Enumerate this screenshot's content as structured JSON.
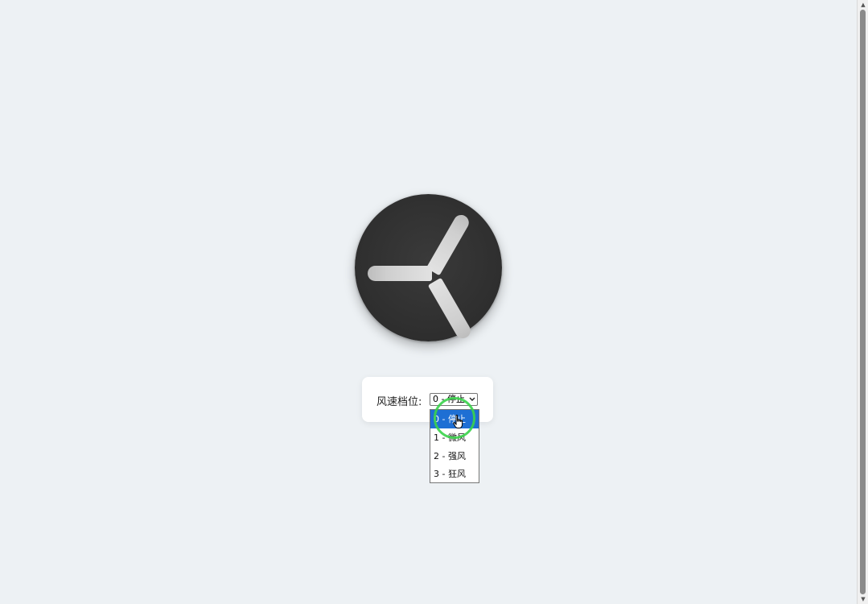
{
  "control": {
    "label": "风速档位:",
    "selected_value": "0 - 停止",
    "options": [
      "0 - 停止",
      "1 - 微风",
      "2 - 强风",
      "3 - 狂风"
    ],
    "highlighted_index": 0
  },
  "fan": {
    "speed_level": 0,
    "blade_count": 3,
    "body_color": "#2e2e2e",
    "blade_color": "#d6d6d6"
  },
  "colors": {
    "page_background": "#edf1f4",
    "highlight": "#1e6fd4",
    "click_ring": "#3ad34a"
  },
  "icons": {
    "select_arrow": "chevron-down-icon",
    "cursor": "hand-pointer-icon"
  }
}
